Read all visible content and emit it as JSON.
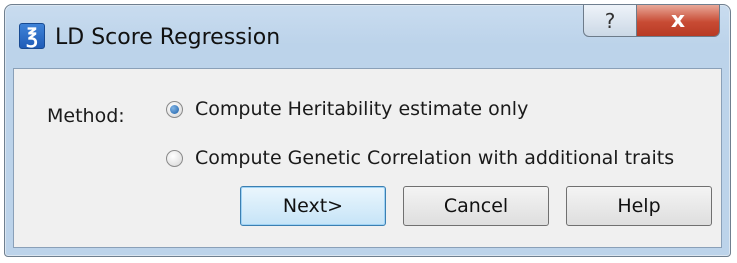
{
  "window": {
    "title": "LD Score Regression",
    "app_icon": "ld-app-icon",
    "help_glyph": "?",
    "close_glyph": "x"
  },
  "form": {
    "method_label": "Method:",
    "options": [
      {
        "label": "Compute Heritability estimate only",
        "selected": true
      },
      {
        "label": "Compute Genetic Correlation with additional traits",
        "selected": false
      }
    ]
  },
  "buttons": {
    "next": "Next>",
    "cancel": "Cancel",
    "help": "Help"
  },
  "colors": {
    "default_button_border": "#3c7fb1",
    "close_button": "#c84b34"
  }
}
